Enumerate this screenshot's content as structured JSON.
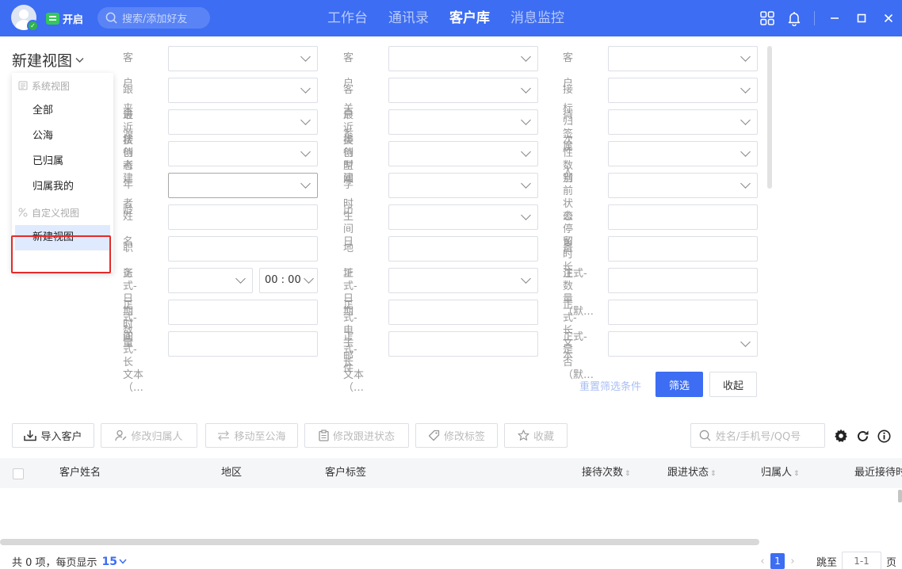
{
  "topbar": {
    "status_label": "开启",
    "search_placeholder": "搜索/添加好友",
    "nav": [
      {
        "label": "工作台",
        "active": false
      },
      {
        "label": "通讯录",
        "active": false
      },
      {
        "label": "客户库",
        "active": true
      },
      {
        "label": "消息监控",
        "active": false
      }
    ],
    "icons": [
      "apps-icon",
      "bell-icon",
      "minimize-icon",
      "maximize-icon",
      "close-icon"
    ]
  },
  "views": {
    "title": "新建视图",
    "system_group": "系统视图",
    "system_items": [
      "全部",
      "公海",
      "已归属",
      "归属我的"
    ],
    "custom_group": "自定义视图",
    "custom_items": [
      "新建视图"
    ]
  },
  "filters": {
    "labels": [
      "客户来源",
      "客户关系",
      "客户标签",
      "跟进状态",
      "客户类型",
      "接待次数",
      "最近接待者",
      "最近接待时间",
      "归属人",
      "创建者",
      "创建时间",
      "性别",
      "年龄",
      "学历",
      "当前状态停留时长",
      "姓名",
      "生日",
      "公司",
      "职务",
      "地址",
      "备注",
      "正式-日期时间",
      "正式-日期",
      "正式-数量（默…",
      "正式-数量",
      "正式-电子邮件",
      "正式-长文本",
      "正式-长文本（…",
      "正式-长文本（…",
      "正式-是否（默…"
    ],
    "label_lines": [
      [
        "客户来源"
      ],
      [
        "客户关系"
      ],
      [
        "客户标签"
      ],
      [
        "跟进状态"
      ],
      [
        "客户类型"
      ],
      [
        "接待次数"
      ],
      [
        "最近接待",
        "者"
      ],
      [
        "最近接待",
        "时间"
      ],
      [
        "归属人"
      ],
      [
        "创建者"
      ],
      [
        "创建时间"
      ],
      [
        "性别"
      ],
      [
        "年龄"
      ],
      [
        "学历"
      ],
      [
        "当前状态",
        "停留时长"
      ],
      [
        "姓名"
      ],
      [
        "生日"
      ],
      [
        "公司"
      ],
      [
        "职务"
      ],
      [
        "地址"
      ],
      [
        "备注"
      ],
      [
        "正式-日",
        "期时间"
      ],
      [
        "正式-日",
        "期"
      ],
      [
        "正式-数",
        "量（默…"
      ],
      [
        "正式-数",
        "量"
      ],
      [
        "正式-电",
        "子邮件"
      ],
      [
        "正式-长",
        "文本"
      ],
      [
        "正式-长",
        "文本（…"
      ],
      [
        "正式-长",
        "文本（…"
      ],
      [
        "正式-是",
        "否（默…"
      ]
    ],
    "time_value": "00 : 00",
    "reset_label": "重置筛选条件",
    "filter_label": "筛选",
    "collapse_label": "收起"
  },
  "toolbar": {
    "import": "导入客户",
    "change_owner": "修改归属人",
    "move_to_pool": "移动至公海",
    "change_status": "修改跟进状态",
    "change_tags": "修改标签",
    "favorite": "收藏",
    "search_placeholder": "姓名/手机号/QQ号"
  },
  "table": {
    "columns": [
      "客户姓名",
      "地区",
      "客户标签",
      "接待次数",
      "跟进状态",
      "归属人",
      "最近接待时"
    ],
    "rows": []
  },
  "footer": {
    "total_text": "共 0 项，每页显示",
    "page_size": "15",
    "current_page": "1",
    "jump_label": "跳至",
    "jump_placeholder": "1-1",
    "page_unit": "页"
  }
}
